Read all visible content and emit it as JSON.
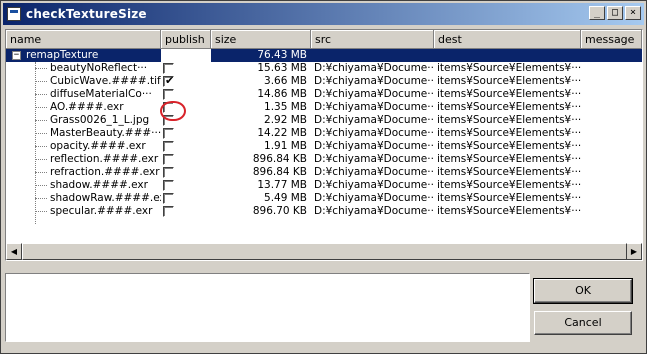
{
  "window": {
    "title": "checkTextureSize"
  },
  "titlebar_buttons": [
    "_",
    "□",
    "×"
  ],
  "columns": [
    "name",
    "publish",
    "size",
    "src",
    "dest",
    "message"
  ],
  "root": {
    "expander": "−",
    "name": "remapTexture",
    "size": "76.43 MB"
  },
  "items": [
    {
      "name": "beautyNoReflect···",
      "publish": false,
      "size": "15.63 MB",
      "src": "D:¥chiyama¥Docume···",
      "dest": "items¥Source¥Elements¥···"
    },
    {
      "name": "CubicWave.####.tif",
      "publish": true,
      "size": "3.66 MB",
      "src": "D:¥chiyama¥Docume···",
      "dest": "items¥Source¥Elements¥···"
    },
    {
      "name": "diffuseMaterialCo···",
      "publish": false,
      "size": "14.86 MB",
      "src": "D:¥chiyama¥Docume···",
      "dest": "items¥Source¥Elements¥···"
    },
    {
      "name": "AO.####.exr",
      "publish": false,
      "size": "1.35 MB",
      "src": "D:¥chiyama¥Docume···",
      "dest": "items¥Source¥Elements¥···"
    },
    {
      "name": "Grass0026_1_L.jpg",
      "publish": false,
      "size": "2.92 MB",
      "src": "D:¥chiyama¥Docume···",
      "dest": "items¥Source¥Elements¥···"
    },
    {
      "name": "MasterBeauty.###···",
      "publish": false,
      "size": "14.22 MB",
      "src": "D:¥chiyama¥Docume···",
      "dest": "items¥Source¥Elements¥···"
    },
    {
      "name": "opacity.####.exr",
      "publish": false,
      "size": "1.91 MB",
      "src": "D:¥chiyama¥Docume···",
      "dest": "items¥Source¥Elements¥···"
    },
    {
      "name": "reflection.####.exr",
      "publish": false,
      "size": "896.84 KB",
      "src": "D:¥chiyama¥Docume···",
      "dest": "items¥Source¥Elements¥···"
    },
    {
      "name": "refraction.####.exr",
      "publish": false,
      "size": "896.84 KB",
      "src": "D:¥chiyama¥Docume···",
      "dest": "items¥Source¥Elements¥···"
    },
    {
      "name": "shadow.####.exr",
      "publish": false,
      "size": "13.77 MB",
      "src": "D:¥chiyama¥Docume···",
      "dest": "items¥Source¥Elements¥···"
    },
    {
      "name": "shadowRaw.####.exr",
      "publish": false,
      "size": "5.49 MB",
      "src": "D:¥chiyama¥Docume···",
      "dest": "items¥Source¥Elements¥···"
    },
    {
      "name": "specular.####.exr",
      "publish": false,
      "size": "896.70 KB",
      "src": "D:¥chiyama¥Docume···",
      "dest": "items¥Source¥Elements¥···"
    }
  ],
  "scroll": {
    "left": "◀",
    "right": "▶"
  },
  "buttons": {
    "ok": "OK",
    "cancel": "Cancel"
  },
  "colors": {
    "selection": "#0a246a",
    "highlight_ring": "#d8232a"
  }
}
